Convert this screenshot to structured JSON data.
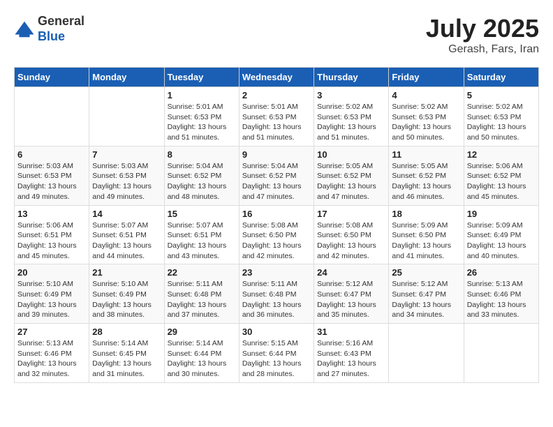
{
  "header": {
    "logo_line1": "General",
    "logo_line2": "Blue",
    "month": "July 2025",
    "location": "Gerash, Fars, Iran"
  },
  "weekdays": [
    "Sunday",
    "Monday",
    "Tuesday",
    "Wednesday",
    "Thursday",
    "Friday",
    "Saturday"
  ],
  "weeks": [
    [
      {
        "day": "",
        "info": ""
      },
      {
        "day": "",
        "info": ""
      },
      {
        "day": "1",
        "info": "Sunrise: 5:01 AM\nSunset: 6:53 PM\nDaylight: 13 hours and 51 minutes."
      },
      {
        "day": "2",
        "info": "Sunrise: 5:01 AM\nSunset: 6:53 PM\nDaylight: 13 hours and 51 minutes."
      },
      {
        "day": "3",
        "info": "Sunrise: 5:02 AM\nSunset: 6:53 PM\nDaylight: 13 hours and 51 minutes."
      },
      {
        "day": "4",
        "info": "Sunrise: 5:02 AM\nSunset: 6:53 PM\nDaylight: 13 hours and 50 minutes."
      },
      {
        "day": "5",
        "info": "Sunrise: 5:02 AM\nSunset: 6:53 PM\nDaylight: 13 hours and 50 minutes."
      }
    ],
    [
      {
        "day": "6",
        "info": "Sunrise: 5:03 AM\nSunset: 6:53 PM\nDaylight: 13 hours and 49 minutes."
      },
      {
        "day": "7",
        "info": "Sunrise: 5:03 AM\nSunset: 6:53 PM\nDaylight: 13 hours and 49 minutes."
      },
      {
        "day": "8",
        "info": "Sunrise: 5:04 AM\nSunset: 6:52 PM\nDaylight: 13 hours and 48 minutes."
      },
      {
        "day": "9",
        "info": "Sunrise: 5:04 AM\nSunset: 6:52 PM\nDaylight: 13 hours and 47 minutes."
      },
      {
        "day": "10",
        "info": "Sunrise: 5:05 AM\nSunset: 6:52 PM\nDaylight: 13 hours and 47 minutes."
      },
      {
        "day": "11",
        "info": "Sunrise: 5:05 AM\nSunset: 6:52 PM\nDaylight: 13 hours and 46 minutes."
      },
      {
        "day": "12",
        "info": "Sunrise: 5:06 AM\nSunset: 6:52 PM\nDaylight: 13 hours and 45 minutes."
      }
    ],
    [
      {
        "day": "13",
        "info": "Sunrise: 5:06 AM\nSunset: 6:51 PM\nDaylight: 13 hours and 45 minutes."
      },
      {
        "day": "14",
        "info": "Sunrise: 5:07 AM\nSunset: 6:51 PM\nDaylight: 13 hours and 44 minutes."
      },
      {
        "day": "15",
        "info": "Sunrise: 5:07 AM\nSunset: 6:51 PM\nDaylight: 13 hours and 43 minutes."
      },
      {
        "day": "16",
        "info": "Sunrise: 5:08 AM\nSunset: 6:50 PM\nDaylight: 13 hours and 42 minutes."
      },
      {
        "day": "17",
        "info": "Sunrise: 5:08 AM\nSunset: 6:50 PM\nDaylight: 13 hours and 42 minutes."
      },
      {
        "day": "18",
        "info": "Sunrise: 5:09 AM\nSunset: 6:50 PM\nDaylight: 13 hours and 41 minutes."
      },
      {
        "day": "19",
        "info": "Sunrise: 5:09 AM\nSunset: 6:49 PM\nDaylight: 13 hours and 40 minutes."
      }
    ],
    [
      {
        "day": "20",
        "info": "Sunrise: 5:10 AM\nSunset: 6:49 PM\nDaylight: 13 hours and 39 minutes."
      },
      {
        "day": "21",
        "info": "Sunrise: 5:10 AM\nSunset: 6:49 PM\nDaylight: 13 hours and 38 minutes."
      },
      {
        "day": "22",
        "info": "Sunrise: 5:11 AM\nSunset: 6:48 PM\nDaylight: 13 hours and 37 minutes."
      },
      {
        "day": "23",
        "info": "Sunrise: 5:11 AM\nSunset: 6:48 PM\nDaylight: 13 hours and 36 minutes."
      },
      {
        "day": "24",
        "info": "Sunrise: 5:12 AM\nSunset: 6:47 PM\nDaylight: 13 hours and 35 minutes."
      },
      {
        "day": "25",
        "info": "Sunrise: 5:12 AM\nSunset: 6:47 PM\nDaylight: 13 hours and 34 minutes."
      },
      {
        "day": "26",
        "info": "Sunrise: 5:13 AM\nSunset: 6:46 PM\nDaylight: 13 hours and 33 minutes."
      }
    ],
    [
      {
        "day": "27",
        "info": "Sunrise: 5:13 AM\nSunset: 6:46 PM\nDaylight: 13 hours and 32 minutes."
      },
      {
        "day": "28",
        "info": "Sunrise: 5:14 AM\nSunset: 6:45 PM\nDaylight: 13 hours and 31 minutes."
      },
      {
        "day": "29",
        "info": "Sunrise: 5:14 AM\nSunset: 6:44 PM\nDaylight: 13 hours and 30 minutes."
      },
      {
        "day": "30",
        "info": "Sunrise: 5:15 AM\nSunset: 6:44 PM\nDaylight: 13 hours and 28 minutes."
      },
      {
        "day": "31",
        "info": "Sunrise: 5:16 AM\nSunset: 6:43 PM\nDaylight: 13 hours and 27 minutes."
      },
      {
        "day": "",
        "info": ""
      },
      {
        "day": "",
        "info": ""
      }
    ]
  ]
}
